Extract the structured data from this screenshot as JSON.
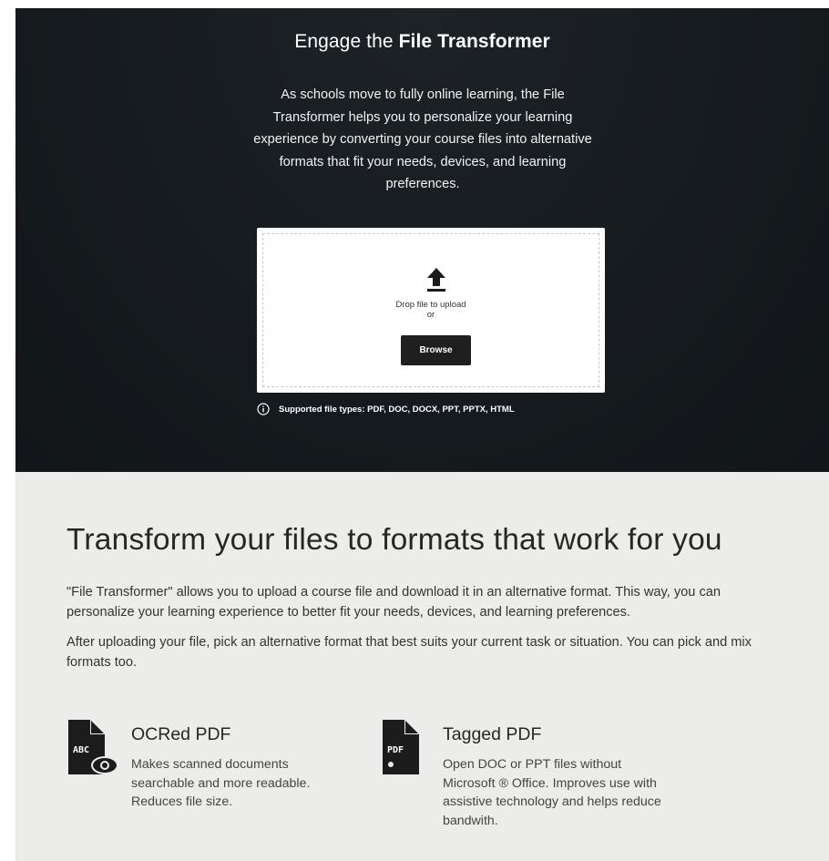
{
  "hero": {
    "title_prefix": "Engage the ",
    "title_strong": "File Transformer",
    "description": "As schools move to fully online learning, the File Transformer helps you to personalize your learning experience by converting your course files into alternative formats that fit your needs, devices, and learning preferences."
  },
  "upload": {
    "drop_label": "Drop file to upload",
    "or_label": "or",
    "browse_label": "Browse",
    "icon": "upload-arrow-icon",
    "supported_text": "Supported file types: PDF, DOC, DOCX, PPT, PPTX, HTML",
    "supported_icon": "info-icon"
  },
  "section": {
    "title": "Transform your files to formats that work for you",
    "paragraph_1": "\"File Transformer\" allows you to upload a course file and download it in an alternative format. This way, you can personalize your learning experience to better fit your needs, devices, and learning preferences.",
    "paragraph_2": "After uploading your file, pick an alternative format that best suits your current task or situation. You can pick and mix formats too.",
    "features": [
      {
        "title": "OCRed PDF",
        "description": "Makes scanned documents searchable and more readable. Reduces file size.",
        "icon": "ocr-file-icon",
        "icon_text": "ABC"
      },
      {
        "title": "Tagged PDF",
        "description": "Open DOC or PPT files without Microsoft ® Office. Improves use with assistive technology and helps reduce bandwith.",
        "icon": "pdf-file-icon",
        "icon_text": "PDF"
      }
    ]
  },
  "colors": {
    "hero_background": "#161b1f",
    "section_background": "#ececeb",
    "button_background": "#1f1f1f"
  }
}
